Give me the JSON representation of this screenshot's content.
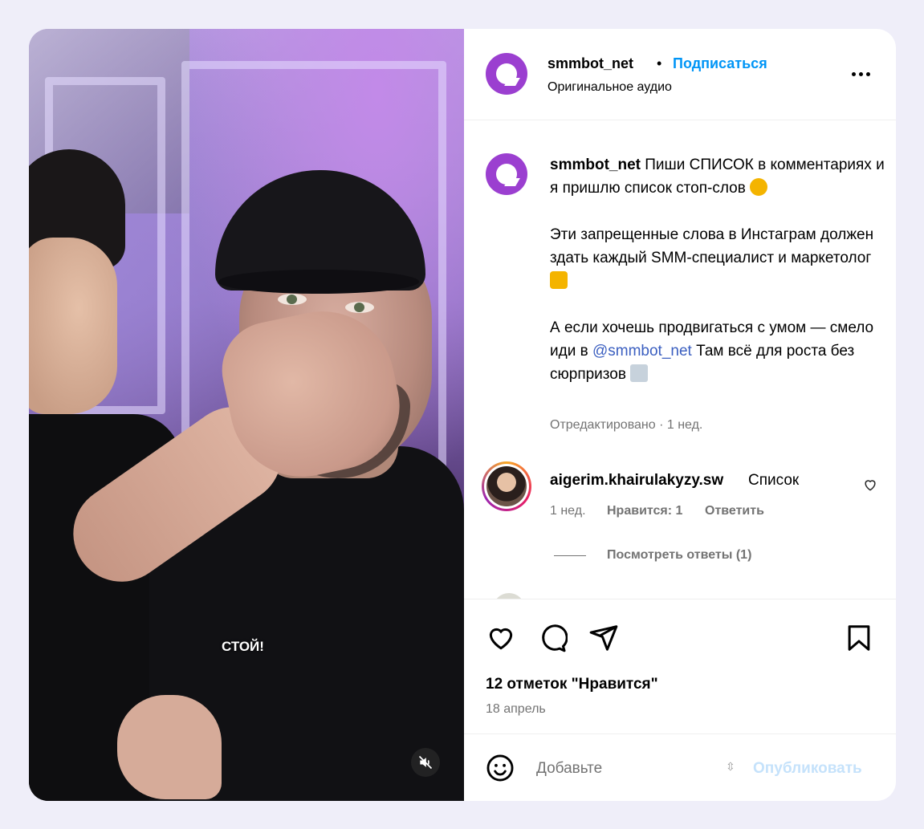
{
  "header": {
    "username": "smmbot_net",
    "separator": "•",
    "follow_label": "Подписаться",
    "audio_label": "Оригинальное аудио"
  },
  "post": {
    "username": "smmbot_net",
    "line1": "Пиши СПИСОК в комментариях и я пришлю список стоп-слов",
    "line2": "Эти запрещенные слова в Инстаграм должен здать каждый SMM-специалист и маркетолог",
    "line3_before": "А если хочешь продвигаться с умом — смело иди в ",
    "mention": "@smmbot_net",
    "line3_after": " Там всё для роста без сюрпризов",
    "edited": "Отредактировано · 1 нед."
  },
  "comment": {
    "username": "aigerim.khairulakyzy.sw",
    "text": "Список",
    "time": "1 нед.",
    "likes": "Нравится: 1",
    "reply_label": "Ответить",
    "view_replies": "Посмотреть ответы (1)"
  },
  "stats": {
    "likes": "12 отметок \"Нравится\"",
    "date": "18 апрель"
  },
  "composer": {
    "placeholder": "Добавьте",
    "publish_label": "Опубликовать"
  },
  "video": {
    "caption": "СТОЙ!"
  },
  "colors": {
    "accent": "#0095f6",
    "brand": "#9b3fd0",
    "muted": "#737373",
    "background": "#efeef9"
  },
  "icons": [
    "more-icon",
    "heart-icon",
    "comment-icon",
    "share-icon",
    "bookmark-icon",
    "emoji-icon",
    "mute-icon"
  ]
}
